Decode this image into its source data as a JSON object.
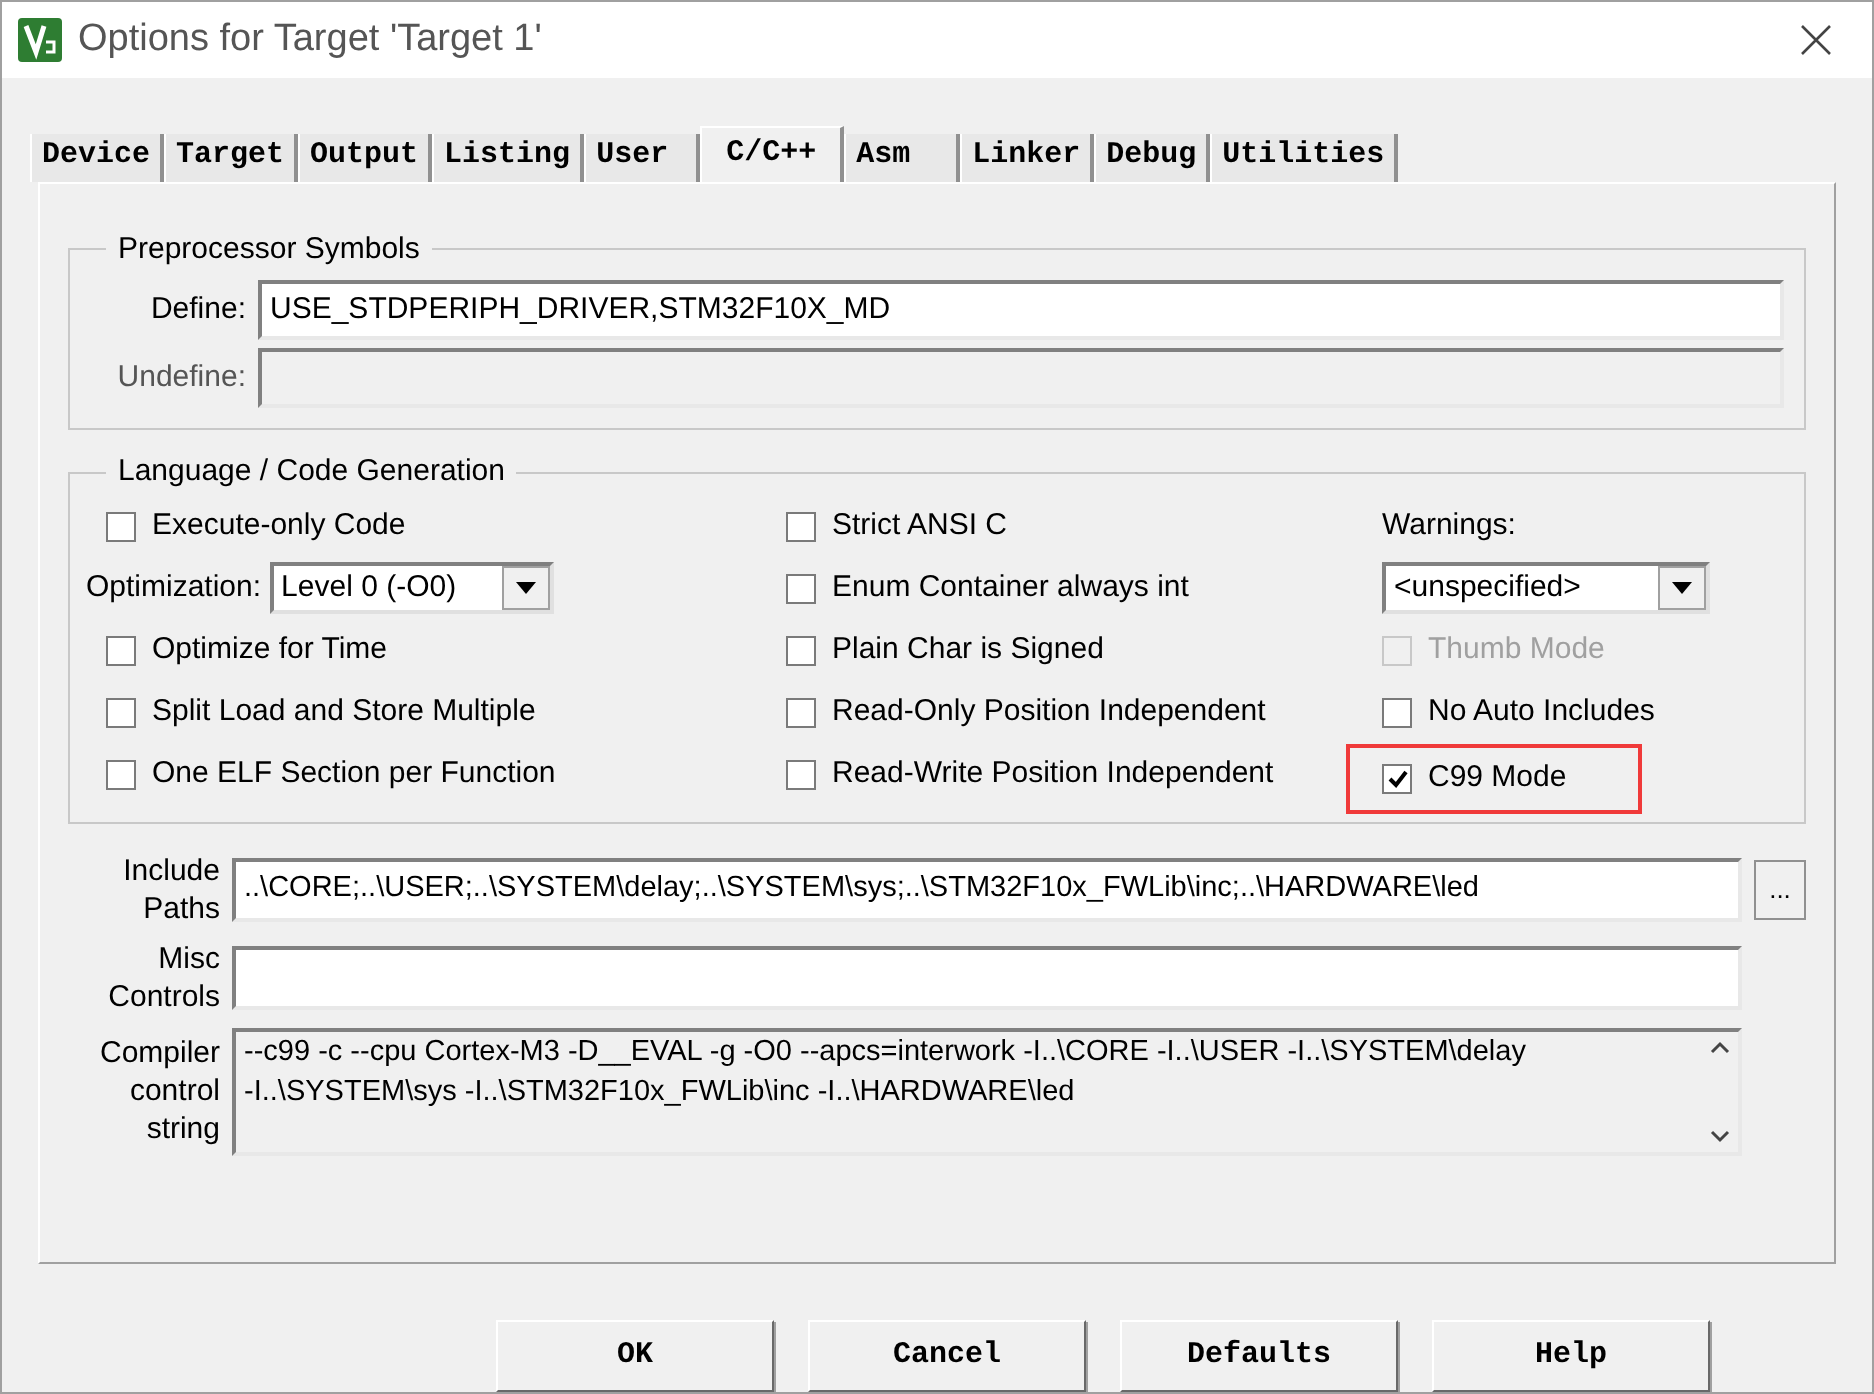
{
  "window": {
    "title": "Options for Target 'Target 1'"
  },
  "tabs": [
    {
      "label": "Device",
      "selected": false
    },
    {
      "label": "Target",
      "selected": false
    },
    {
      "label": "Output",
      "selected": false
    },
    {
      "label": "Listing",
      "selected": false
    },
    {
      "label": "User",
      "selected": false
    },
    {
      "label": "C/C++",
      "selected": true
    },
    {
      "label": "Asm",
      "selected": false
    },
    {
      "label": "Linker",
      "selected": false
    },
    {
      "label": "Debug",
      "selected": false
    },
    {
      "label": "Utilities",
      "selected": false
    }
  ],
  "preprocessor": {
    "title": "Preprocessor Symbols",
    "fields": [
      {
        "label": "Define:",
        "value": "USE_STDPERIPH_DRIVER,STM32F10X_MD",
        "disabled": false
      },
      {
        "label": "Undefine:",
        "disabled": true
      }
    ]
  },
  "language": {
    "title": "Language / Code Generation",
    "columns": [
      [
        {
          "kind": "checkbox",
          "label": "Execute-only Code",
          "checked": false,
          "disabled": false,
          "highlighted": false
        },
        {
          "kind": "select",
          "label": "Optimization:",
          "value": "Level 0 (-O0)"
        },
        {
          "kind": "checkbox",
          "label": "Optimize for Time",
          "checked": false,
          "disabled": false,
          "highlighted": false
        },
        {
          "kind": "checkbox",
          "label": "Split Load and Store Multiple",
          "checked": false,
          "disabled": false,
          "highlighted": false
        },
        {
          "kind": "checkbox",
          "label": "One ELF Section per Function",
          "checked": false,
          "disabled": false,
          "highlighted": false
        }
      ],
      [
        {
          "kind": "checkbox",
          "label": "Strict ANSI C",
          "checked": false,
          "disabled": false,
          "highlighted": false
        },
        {
          "kind": "checkbox",
          "label": "Enum Container always int",
          "checked": false,
          "disabled": false,
          "highlighted": false
        },
        {
          "kind": "checkbox",
          "label": "Plain Char is Signed",
          "checked": false,
          "disabled": false,
          "highlighted": false
        },
        {
          "kind": "checkbox",
          "label": "Read-Only Position Independent",
          "checked": false,
          "disabled": false,
          "highlighted": false
        },
        {
          "kind": "checkbox",
          "label": "Read-Write Position Independent",
          "checked": false,
          "disabled": false,
          "highlighted": false
        }
      ],
      [
        {
          "kind": "label",
          "label": "Warnings:"
        },
        {
          "kind": "select",
          "value": "<unspecified>"
        },
        {
          "kind": "checkbox",
          "label": "Thumb Mode",
          "checked": false,
          "disabled": true,
          "highlighted": false
        },
        {
          "kind": "checkbox",
          "label": "No Auto Includes",
          "checked": false,
          "disabled": false,
          "highlighted": false
        },
        {
          "kind": "checkbox",
          "label": "C99 Mode",
          "checked": true,
          "disabled": false,
          "highlighted": true
        }
      ]
    ]
  },
  "include_paths": {
    "label": "Include Paths",
    "value": "..\\CORE;..\\USER;..\\SYSTEM\\delay;..\\SYSTEM\\sys;..\\STM32F10x_FWLib\\inc;..\\HARDWARE\\led",
    "browse": "..."
  },
  "misc_controls": {
    "label": "Misc Controls"
  },
  "compiler_string": {
    "label": "Compiler control string",
    "lines": [
      "--c99 -c --cpu Cortex-M3 -D__EVAL -g -O0 --apcs=interwork -I..\\CORE -I..\\USER -I..\\SYSTEM\\delay",
      "-I..\\SYSTEM\\sys -I..\\STM32F10x_FWLib\\inc -I..\\HARDWARE\\led"
    ]
  },
  "buttons": [
    "OK",
    "Cancel",
    "Defaults",
    "Help"
  ]
}
